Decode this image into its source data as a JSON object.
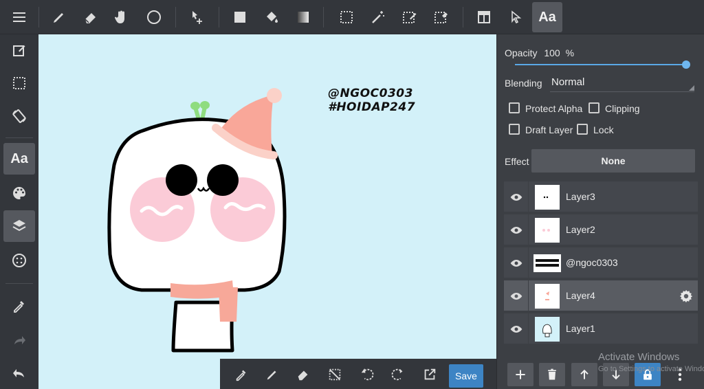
{
  "toolbar": {
    "text_tool_label": "Aa"
  },
  "leftbar": {
    "text_label": "Aa"
  },
  "canvas": {
    "watermark_line1": "@NGOC0303",
    "watermark_line2": "#HOIDAP247",
    "background_color": "#d3f1f9"
  },
  "bottombar": {
    "save_label": "Save"
  },
  "panel": {
    "opacity_label": "Opacity",
    "opacity_value": "100",
    "opacity_unit": "%",
    "opacity_fraction": 1.0,
    "blending_label": "Blending",
    "blending_value": "Normal",
    "protect_alpha_label": "Protect Alpha",
    "clipping_label": "Clipping",
    "draft_layer_label": "Draft Layer",
    "lock_label": "Lock",
    "effect_label": "Effect",
    "effect_value": "None"
  },
  "layers": [
    {
      "name": "Layer3",
      "selected": false
    },
    {
      "name": "Layer2",
      "selected": false
    },
    {
      "name": "@ngoc0303",
      "selected": false
    },
    {
      "name": "Layer4",
      "selected": true
    },
    {
      "name": "Layer1",
      "selected": false
    }
  ],
  "os_overlay": {
    "title": "Activate Windows",
    "subtitle": "Go to Settings to activate Windows."
  },
  "colors": {
    "accent": "#3d84c4",
    "toolbar_bg": "#33363b",
    "panel_bg": "#3c3f44"
  }
}
